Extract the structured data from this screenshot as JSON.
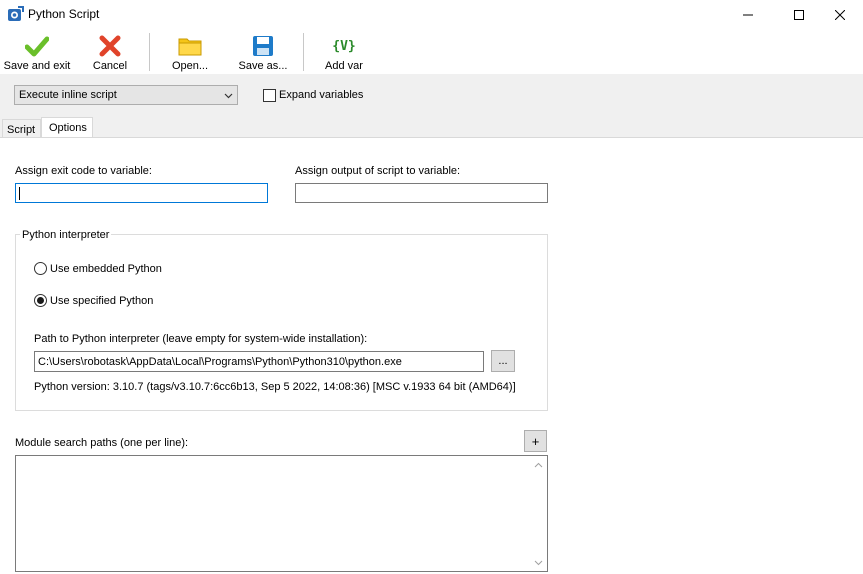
{
  "window": {
    "title": "Python Script",
    "minimize_glyph": "—",
    "maximize_glyph": "☐",
    "close_glyph": "✕"
  },
  "toolbar": {
    "save_exit_label": "Save and exit",
    "cancel_label": "Cancel",
    "open_label": "Open...",
    "save_as_label": "Save as...",
    "add_var_label": "Add var",
    "add_var_glyph": "{V}"
  },
  "mode": {
    "selected": "Execute inline script",
    "expand_variables_label": "Expand variables",
    "expand_variables_checked": false
  },
  "tabs": [
    {
      "label": "Script",
      "active": false
    },
    {
      "label": "Options",
      "active": true
    }
  ],
  "options": {
    "exit_code_label": "Assign exit code to variable:",
    "exit_code_value": "",
    "output_label": "Assign output of script to variable:",
    "output_value": "",
    "interpreter_group_title": "Python interpreter",
    "embedded_label": "Use embedded Python",
    "specified_label": "Use specified Python",
    "selected_interpreter": "specified",
    "path_label": "Path to Python interpreter (leave empty for system-wide installation):",
    "path_value": "C:\\Users\\robotask\\AppData\\Local\\Programs\\Python\\Python310\\python.exe",
    "browse_label": "...",
    "version_text": "Python version: 3.10.7 (tags/v3.10.7:6cc6b13, Sep  5 2022, 14:08:36) [MSC v.1933 64 bit (AMD64)]",
    "module_paths_label": "Module search paths (one per line):",
    "add_path_label": "+",
    "module_paths_value": ""
  },
  "colors": {
    "save_exit_icon": "#6abf2a",
    "cancel_icon": "#e0432a",
    "open_icon": "#f5c518",
    "save_as_icon": "#1e7bc9",
    "add_var_icon": "#2a8a2a",
    "focus_border": "#0078d7"
  }
}
